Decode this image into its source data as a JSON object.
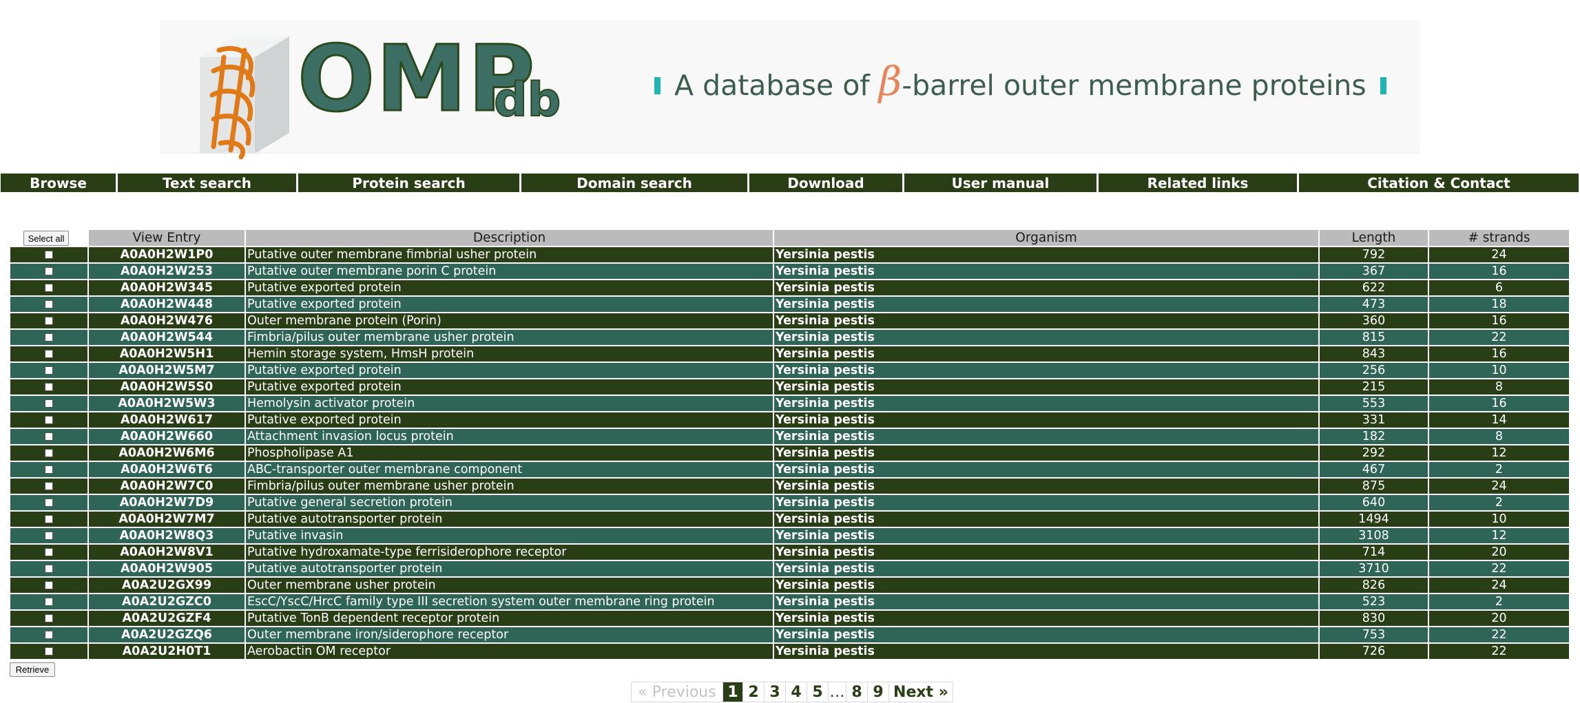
{
  "banner": {
    "logo_main": "OMP",
    "logo_sub": "db",
    "tagline_pre": "A database of ",
    "tagline_beta": "β",
    "tagline_post": "-barrel outer membrane proteins"
  },
  "nav": [
    {
      "label": "Browse"
    },
    {
      "label": "Text search"
    },
    {
      "label": "Protein search"
    },
    {
      "label": "Domain search"
    },
    {
      "label": "Download"
    },
    {
      "label": "User manual"
    },
    {
      "label": "Related links"
    },
    {
      "label": "Citation & Contact"
    }
  ],
  "table": {
    "select_all_label": "Select all",
    "headers": {
      "entry": "View Entry",
      "description": "Description",
      "organism": "Organism",
      "length": "Length",
      "strands": "# strands"
    },
    "rows": [
      {
        "entry": "A0A0H2W1P0",
        "description": "Putative outer membrane fimbrial usher protein",
        "organism": "Yersinia pestis",
        "length": "792",
        "strands": "24"
      },
      {
        "entry": "A0A0H2W253",
        "description": "Putative outer membrane porin C protein",
        "organism": "Yersinia pestis",
        "length": "367",
        "strands": "16"
      },
      {
        "entry": "A0A0H2W345",
        "description": "Putative exported protein",
        "organism": "Yersinia pestis",
        "length": "622",
        "strands": "6"
      },
      {
        "entry": "A0A0H2W448",
        "description": "Putative exported protein",
        "organism": "Yersinia pestis",
        "length": "473",
        "strands": "18"
      },
      {
        "entry": "A0A0H2W476",
        "description": "Outer membrane protein (Porin)",
        "organism": "Yersinia pestis",
        "length": "360",
        "strands": "16"
      },
      {
        "entry": "A0A0H2W544",
        "description": "Fimbria/pilus outer membrane usher protein",
        "organism": "Yersinia pestis",
        "length": "815",
        "strands": "22"
      },
      {
        "entry": "A0A0H2W5H1",
        "description": "Hemin storage system, HmsH protein",
        "organism": "Yersinia pestis",
        "length": "843",
        "strands": "16"
      },
      {
        "entry": "A0A0H2W5M7",
        "description": "Putative exported protein",
        "organism": "Yersinia pestis",
        "length": "256",
        "strands": "10"
      },
      {
        "entry": "A0A0H2W5S0",
        "description": "Putative exported protein",
        "organism": "Yersinia pestis",
        "length": "215",
        "strands": "8"
      },
      {
        "entry": "A0A0H2W5W3",
        "description": "Hemolysin activator protein",
        "organism": "Yersinia pestis",
        "length": "553",
        "strands": "16"
      },
      {
        "entry": "A0A0H2W617",
        "description": "Putative exported protein",
        "organism": "Yersinia pestis",
        "length": "331",
        "strands": "14"
      },
      {
        "entry": "A0A0H2W660",
        "description": "Attachment invasion locus protein",
        "organism": "Yersinia pestis",
        "length": "182",
        "strands": "8"
      },
      {
        "entry": "A0A0H2W6M6",
        "description": "Phospholipase A1",
        "organism": "Yersinia pestis",
        "length": "292",
        "strands": "12"
      },
      {
        "entry": "A0A0H2W6T6",
        "description": "ABC-transporter outer membrane component",
        "organism": "Yersinia pestis",
        "length": "467",
        "strands": "2"
      },
      {
        "entry": "A0A0H2W7C0",
        "description": "Fimbria/pilus outer membrane usher protein",
        "organism": "Yersinia pestis",
        "length": "875",
        "strands": "24"
      },
      {
        "entry": "A0A0H2W7D9",
        "description": "Putative general secretion protein",
        "organism": "Yersinia pestis",
        "length": "640",
        "strands": "2"
      },
      {
        "entry": "A0A0H2W7M7",
        "description": "Putative autotransporter protein",
        "organism": "Yersinia pestis",
        "length": "1494",
        "strands": "10"
      },
      {
        "entry": "A0A0H2W8Q3",
        "description": "Putative invasin",
        "organism": "Yersinia pestis",
        "length": "3108",
        "strands": "12"
      },
      {
        "entry": "A0A0H2W8V1",
        "description": "Putative hydroxamate-type ferrisiderophore receptor",
        "organism": "Yersinia pestis",
        "length": "714",
        "strands": "20"
      },
      {
        "entry": "A0A0H2W905",
        "description": "Putative autotransporter protein",
        "organism": "Yersinia pestis",
        "length": "3710",
        "strands": "22"
      },
      {
        "entry": "A0A2U2GX99",
        "description": "Outer membrane usher protein",
        "organism": "Yersinia pestis",
        "length": "826",
        "strands": "24"
      },
      {
        "entry": "A0A2U2GZC0",
        "description": "EscC/YscC/HrcC family type III secretion system outer membrane ring protein",
        "organism": "Yersinia pestis",
        "length": "523",
        "strands": "2"
      },
      {
        "entry": "A0A2U2GZF4",
        "description": "Putative TonB dependent receptor protein",
        "organism": "Yersinia pestis",
        "length": "830",
        "strands": "20"
      },
      {
        "entry": "A0A2U2GZQ6",
        "description": "Outer membrane iron/siderophore receptor",
        "organism": "Yersinia pestis",
        "length": "753",
        "strands": "22"
      },
      {
        "entry": "A0A2U2H0T1",
        "description": "Aerobactin OM receptor",
        "organism": "Yersinia pestis",
        "length": "726",
        "strands": "22"
      }
    ],
    "retrieve_label": "Retrieve"
  },
  "pagination": {
    "previous": "« Previous",
    "pages": [
      "1",
      "2",
      "3",
      "4",
      "5",
      "…",
      "8",
      "9"
    ],
    "current": "1",
    "next": "Next »"
  },
  "colors": {
    "dark_row": "#2a3e16",
    "light_row": "#2f6557",
    "header_bg": "#bbbbbb",
    "accent_teal": "#21b5b2",
    "beta_orange": "#e8845a"
  }
}
